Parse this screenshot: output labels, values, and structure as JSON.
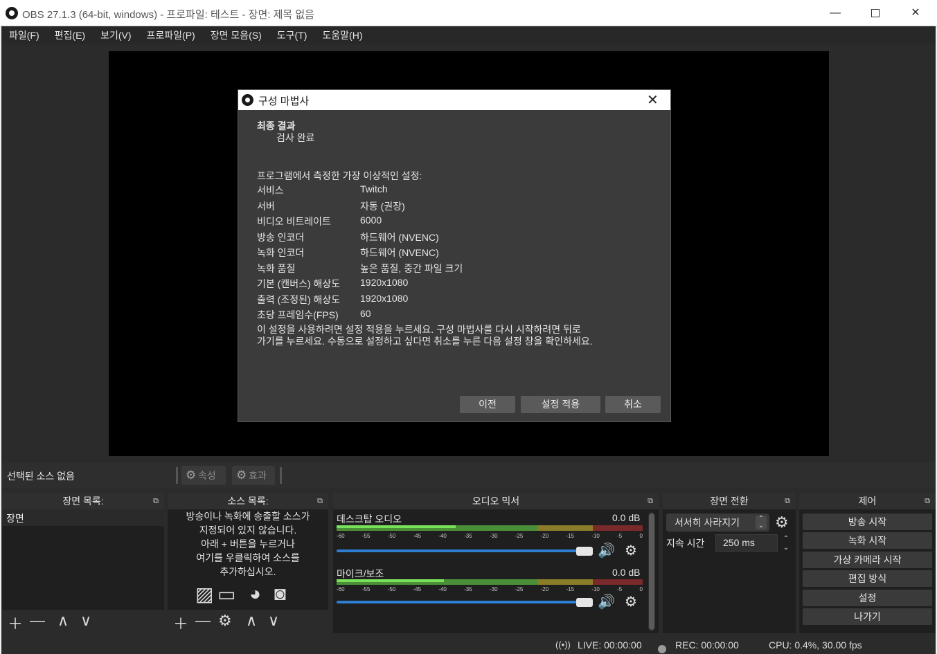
{
  "window": {
    "title": "OBS 27.1.3 (64-bit, windows) - 프로파일: 테스트 - 장면: 제목 없음",
    "minimize": "—",
    "close": "✕"
  },
  "menu": [
    "파일(F)",
    "편집(E)",
    "보기(V)",
    "프로파일(P)",
    "장면 모음(S)",
    "도구(T)",
    "도움말(H)"
  ],
  "dialog": {
    "title": "구성 마법사",
    "close": "✕",
    "heading": "최종 결과",
    "subheading": "검사 완료",
    "intro": "프로그램에서 측정한 가장 이상적인 설정:",
    "rows": [
      {
        "key": "서비스",
        "value": "Twitch"
      },
      {
        "key": "서버",
        "value": "자동 (권장)"
      },
      {
        "key": "비디오 비트레이트",
        "value": "6000"
      },
      {
        "key": "방송 인코더",
        "value": "하드웨어 (NVENC)"
      },
      {
        "key": "녹화 인코더",
        "value": "하드웨어 (NVENC)"
      },
      {
        "key": "녹화 품질",
        "value": "높은 품질, 중간 파일 크기"
      },
      {
        "key": "기본 (캔버스) 해상도",
        "value": "1920x1080"
      },
      {
        "key": "출력 (조정된) 해상도",
        "value": "1920x1080"
      },
      {
        "key": "초당 프레임수(FPS)",
        "value": "60"
      }
    ],
    "note_line1": "이 설정을 사용하려면 설정 적용을 누르세요. 구성 마법사를 다시 시작하려면 뒤로",
    "note_line2": "가기를 누르세요. 수동으로 설정하고 싶다면 취소를 누른 다음 설정 창을 확인하세요.",
    "buttons": {
      "prev": "이전",
      "apply": "설정 적용",
      "cancel": "취소"
    }
  },
  "source_toolbar": {
    "no_source": "선택된 소스 없음",
    "properties": "속성",
    "filters": "효과"
  },
  "scenes": {
    "header": "장면 목록:",
    "items": [
      "장면"
    ]
  },
  "sources": {
    "header": "소스 목록:",
    "empty_lines": [
      "방송이나 녹화에 송출할 소스가",
      "지정되어 있지 않습니다.",
      "아래 + 버튼을 누르거나",
      "여기를 우클릭하여 소스를",
      "추가하십시오."
    ]
  },
  "mixer": {
    "header": "오디오 믹서",
    "scale": [
      "-60",
      "-55",
      "-50",
      "-45",
      "-40",
      "-35",
      "-30",
      "-25",
      "-20",
      "-15",
      "-10",
      "-5",
      "0"
    ],
    "channels": [
      {
        "name": "데스크탑 오디오",
        "db": "0.0 dB",
        "level": 0.39
      },
      {
        "name": "마이크/보조",
        "db": "0.0 dB",
        "level": 0.35
      }
    ]
  },
  "transitions": {
    "header": "장면 전환",
    "selected": "서서히 사라지기",
    "duration_label": "지속 시간",
    "duration": "250 ms"
  },
  "controls": {
    "header": "제어",
    "buttons": [
      "방송 시작",
      "녹화 시작",
      "가상 카메라 시작",
      "편집 방식",
      "설정",
      "나가기"
    ]
  },
  "status": {
    "live": "LIVE: 00:00:00",
    "rec": "REC: 00:00:00",
    "cpu": "CPU: 0.4%, 30.00 fps"
  }
}
